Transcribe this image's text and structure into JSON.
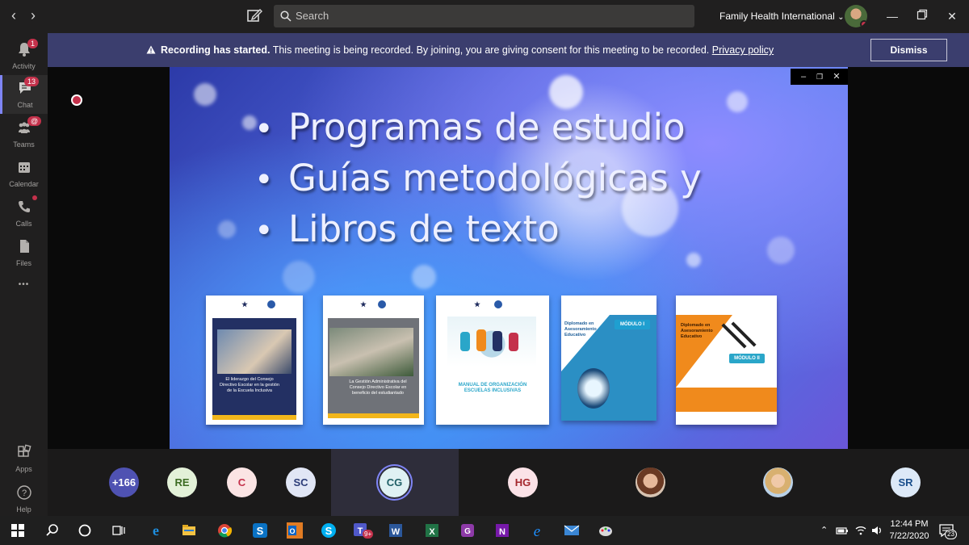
{
  "titlebar": {
    "search_placeholder": "Search",
    "org_name": "Family Health International",
    "org_caret": "⌄",
    "back_glyph": "‹",
    "forward_glyph": "›",
    "icons": [
      "chevron-left-icon",
      "chevron-right-icon",
      "compose-icon",
      "search-icon",
      "minimize-icon",
      "restore-icon",
      "close-icon"
    ]
  },
  "rail": {
    "items": [
      {
        "label": "Activity",
        "badge": "1",
        "icon": "bell-icon"
      },
      {
        "label": "Chat",
        "badge": "13",
        "icon": "chat-icon",
        "active": true
      },
      {
        "label": "Teams",
        "badge": "@",
        "icon": "teams-icon"
      },
      {
        "label": "Calendar",
        "icon": "calendar-icon"
      },
      {
        "label": "Calls",
        "icon": "phone-icon"
      },
      {
        "label": "Files",
        "icon": "file-icon"
      }
    ],
    "more": "•••",
    "apps_label": "Apps",
    "help_label": "Help"
  },
  "banner": {
    "strong": "Recording has started.",
    "message": " This meeting is being recorded. By joining, you are giving consent for this meeting to be recorded. ",
    "link": "Privacy policy",
    "dismiss_label": "Dismiss"
  },
  "slide": {
    "bullets": [
      "Programas de estudio",
      "Guías metodológicas y",
      "Libros de texto"
    ],
    "books": [
      {
        "title": "El liderazgo del Consejo Directivo Escolar en la gestión de la Escuela Inclusiva",
        "accent": "#f2b61b",
        "body": "#233063"
      },
      {
        "title": "La Gestión Administrativa del Consejo Directivo Escolar en beneficio del estudiantado",
        "accent": "#f2b61b",
        "body": "#6f7278"
      },
      {
        "title": "MANUAL DE ORGANIZACIÓN ESCUELAS INCLUSIVAS",
        "accent": "#2aa6c9",
        "body": "#ffffff"
      },
      {
        "title": "Diplomado en Asesoramiento Educativo",
        "module": "MÓDULO I",
        "accent": "#1f9fd0",
        "body": "#2b8fc4"
      },
      {
        "title": "Diplomado en Asesoramiento Educativo",
        "module": "MÓDULO II",
        "accent": "#f08a1c",
        "body": "#ffffff"
      }
    ]
  },
  "participants": [
    {
      "initials": "+166",
      "bg": "#4f52b2",
      "fg": "#ffffff"
    },
    {
      "initials": "RE",
      "bg": "#e3f1d8",
      "fg": "#3c6b22"
    },
    {
      "initials": "C",
      "bg": "#fbe4e4",
      "fg": "#c4314b"
    },
    {
      "initials": "SC",
      "bg": "#e1e6f5",
      "fg": "#2c3c78"
    },
    {
      "initials": "CG",
      "bg": "#dff1f3",
      "fg": "#1f5f66"
    },
    {
      "initials": "HG",
      "bg": "#fbe2e7",
      "fg": "#a4262c"
    },
    {
      "initials": "",
      "photo": "participant-photo-1"
    },
    {
      "initials": "",
      "photo": "participant-photo-2"
    },
    {
      "initials": "SR",
      "bg": "#dde9f7",
      "fg": "#1a4f8c"
    }
  ],
  "taskbar": {
    "time": "12:44 PM",
    "date": "7/22/2020",
    "notifications": "23",
    "teams_badge": "9+",
    "apps": [
      "windows-start-icon",
      "search-icon",
      "cortana-icon",
      "task-view-icon",
      "edge-icon",
      "file-explorer-icon",
      "chrome-icon",
      "skype-business-icon",
      "outlook-icon",
      "skype-icon",
      "teams-icon",
      "word-icon",
      "excel-icon",
      "pdf-icon",
      "onenote-icon",
      "ie-icon",
      "mail-icon",
      "paint-icon"
    ]
  },
  "colors": {
    "accent": "#7f85f5",
    "banner": "#3b3e6e",
    "recording": "#c4314b"
  }
}
